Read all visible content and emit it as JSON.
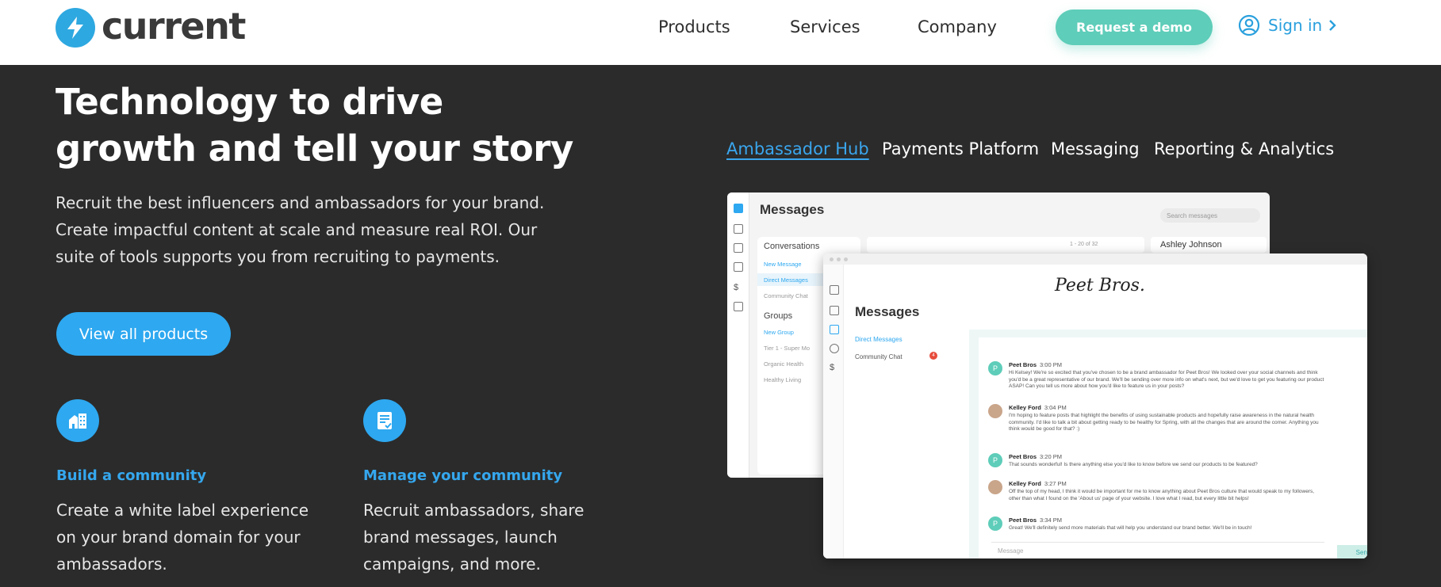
{
  "header": {
    "brand": "current",
    "nav": [
      "Products",
      "Services",
      "Company"
    ],
    "demo_label": "Request a demo",
    "signin_label": "Sign in"
  },
  "hero": {
    "title": "Technology to drive growth and tell your story",
    "description": "Recruit the best influencers and ambassadors for your brand. Create impactful content at scale and measure real ROI. Our suite of tools supports you from recruiting to payments.",
    "cta_label": "View all products"
  },
  "features": [
    {
      "title": "Build a community",
      "description": "Create a white label experience on your brand domain for your ambassadors."
    },
    {
      "title": "Manage your community",
      "description": "Recruit ambassadors, share brand messages, launch campaigns, and more."
    }
  ],
  "tabs": [
    {
      "label": "Ambassador Hub",
      "active": true
    },
    {
      "label": "Payments Platform",
      "active": false
    },
    {
      "label": "Messaging",
      "active": false
    },
    {
      "label": "Reporting & Analytics",
      "active": false
    }
  ],
  "mock_back": {
    "title": "Messages",
    "search_placeholder": "Search messages",
    "conversations_heading": "Conversations",
    "new_message": "New Message",
    "direct_messages": "Direct Messages",
    "community_chat": "Community Chat",
    "groups_heading": "Groups",
    "new_group": "New Group",
    "group_items": [
      "Tier 1 - Super Mo",
      "Organic Health",
      "Healthy Living"
    ],
    "count": "1 - 20 of 32",
    "contact": "Ashley Johnson"
  },
  "mock_front": {
    "brand": "Peet Bros.",
    "title": "Messages",
    "direct_messages": "Direct Messages",
    "community_chat": "Community Chat",
    "badge": "4",
    "messages": [
      {
        "sender": "Peet Bros",
        "time": "3:00 PM",
        "avatar": "P",
        "text": "Hi Kelsey! We're so excited that you've chosen to be a brand ambassador for Peet Bros! We looked over your social channels and think you'd be a great representative of our brand. We'll be sending over more info on what's next, but we'd love to get you featuring our product ASAP! Can you tell us more about how you'd like to feature us in your posts?"
      },
      {
        "sender": "Kelley Ford",
        "time": "3:04 PM",
        "avatar": "",
        "text": "I'm hoping to feature posts that highlight the benefits of using sustainable products and hopefully raise awareness in the natural health community. I'd like to talk a bit about getting ready to be healthy for Spring, with all the changes that are around the corner. Anything you think would be good for that? :)"
      },
      {
        "sender": "Peet Bros",
        "time": "3:20 PM",
        "avatar": "P",
        "text": "That sounds wonderful! Is there anything else you'd like to know before we send our products to be featured?"
      },
      {
        "sender": "Kelley Ford",
        "time": "3:27 PM",
        "avatar": "",
        "text": "Off the top of my head, I think it would be important for me to know anything about Peet Bros culture that would speak to my followers, other than what I found on the 'About us' page of your website. I love what I read, but every little bit helps!"
      },
      {
        "sender": "Peet Bros",
        "time": "3:34 PM",
        "avatar": "P",
        "text": "Great! We'll definitely send more materials that will help you understand our brand better. We'll be in touch!"
      }
    ],
    "input_placeholder": "Message",
    "send_label": "Send"
  },
  "colors": {
    "accent": "#2ea8f0",
    "teal": "#5ecdb9",
    "dark_bg": "#2b2b2b"
  }
}
